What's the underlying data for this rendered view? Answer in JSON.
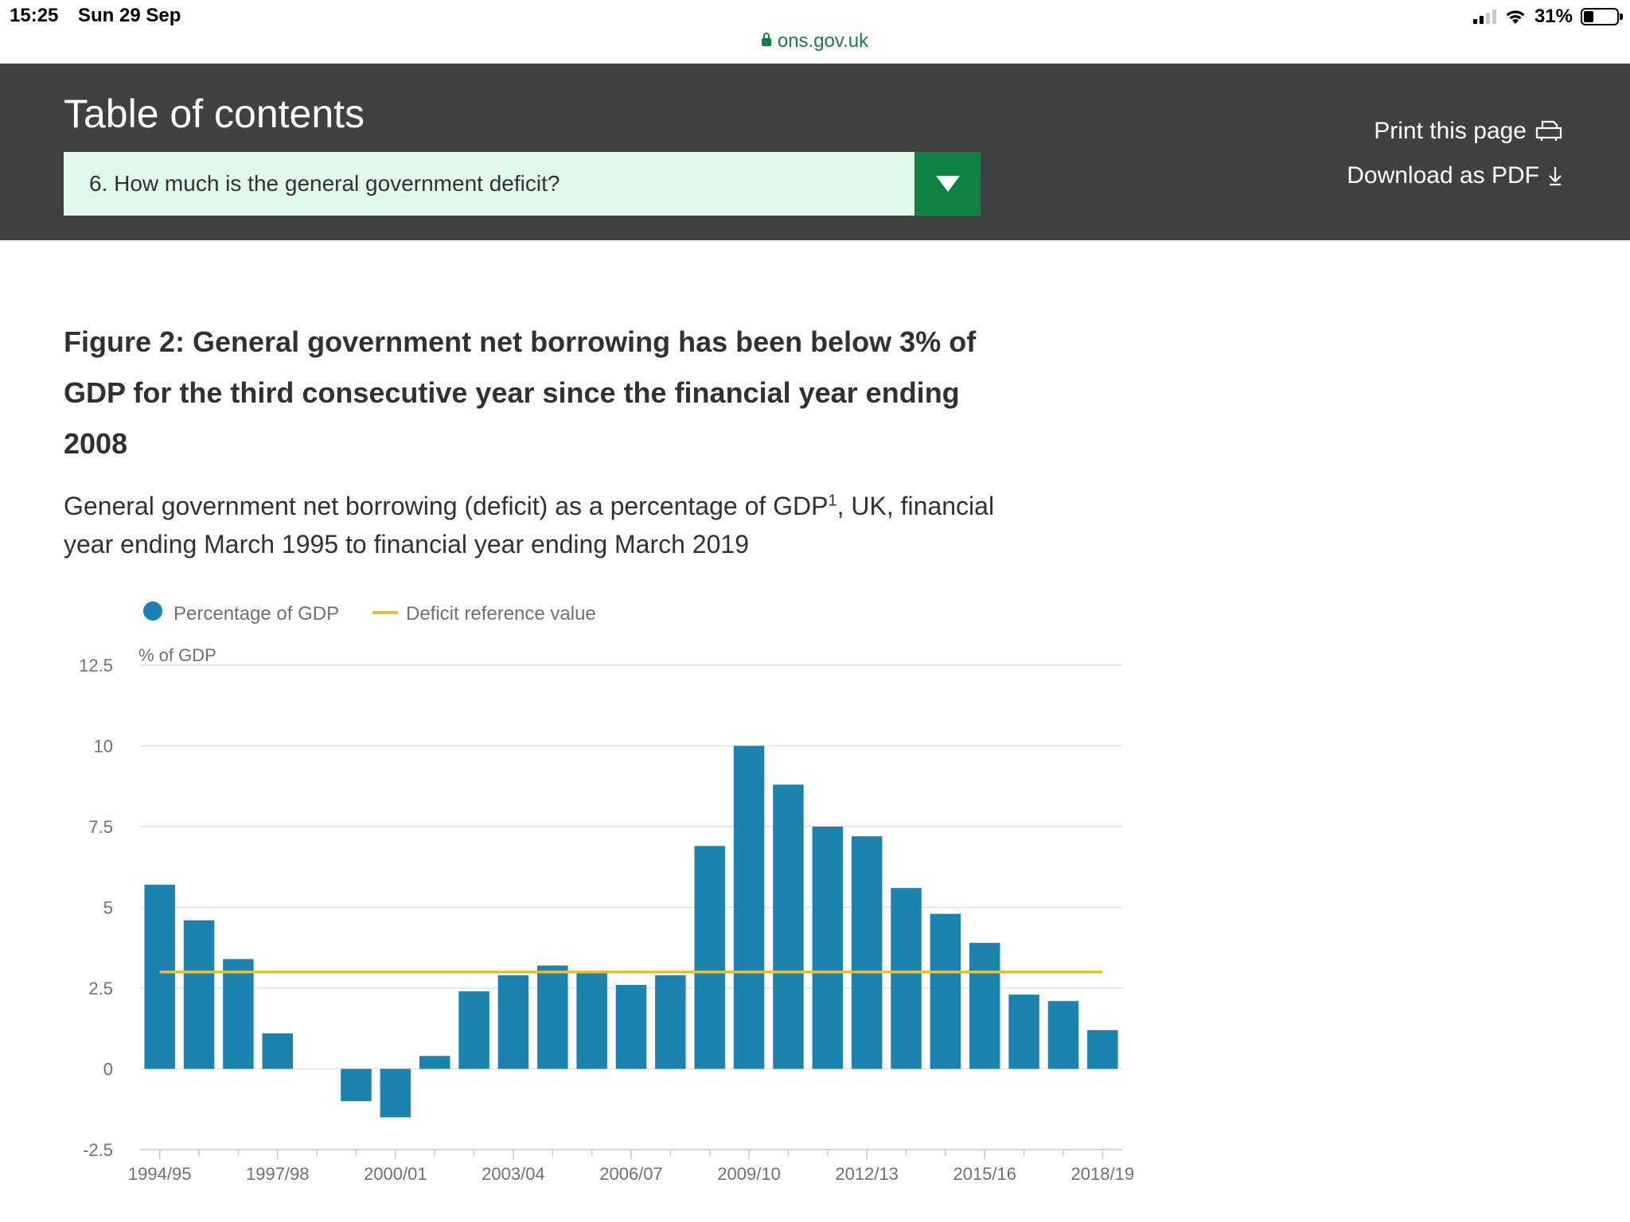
{
  "status_bar": {
    "time": "15:25",
    "date": "Sun 29 Sep",
    "battery": "31%",
    "battery_level": 0.31,
    "url": "ons.gov.uk"
  },
  "toc": {
    "title": "Table of contents",
    "selected": "6. How much is the general government deficit?",
    "print_label": "Print this page",
    "download_label": "Download as PDF",
    "icons": {
      "dropdown": "triangle-down-icon",
      "print": "printer-icon",
      "download": "arrow-down-icon"
    }
  },
  "colors": {
    "header_bg": "#414042",
    "select_bg": "#e0f9eb",
    "accent_green": "#0f8243",
    "bar_blue": "#1b83b0",
    "reference_yellow": "#e5bf3c",
    "text": "#323132"
  },
  "figure": {
    "title": "Figure 2: General government net borrowing has been below 3% of GDP for the third consecutive year since the financial year ending 2008",
    "subtitle_main": "General government net borrowing (deficit) as a percentage of GDP",
    "subtitle_sup": "1",
    "subtitle_tail": ", UK, financial year ending March 1995 to financial year ending March 2019"
  },
  "chart_data": {
    "type": "bar",
    "ylabel": "% of GDP",
    "ylim": [
      -2.5,
      12.5
    ],
    "yticks": [
      -2.5,
      0,
      2.5,
      5,
      7.5,
      10,
      12.5
    ],
    "ytick_labels": [
      "-2.5",
      "0",
      "2.5",
      "5",
      "7.5",
      "10",
      "12.5"
    ],
    "grid": true,
    "legend_position": "top-left",
    "categories": [
      "1994/95",
      "1995/96",
      "1996/97",
      "1997/98",
      "1998/99",
      "1999/00",
      "2000/01",
      "2001/02",
      "2002/03",
      "2003/04",
      "2004/05",
      "2005/06",
      "2006/07",
      "2007/08",
      "2008/09",
      "2009/10",
      "2010/11",
      "2011/12",
      "2012/13",
      "2013/14",
      "2014/15",
      "2015/16",
      "2016/17",
      "2017/18",
      "2018/19"
    ],
    "xtick_labels": [
      "1994/95",
      "1997/98",
      "2000/01",
      "2003/04",
      "2006/07",
      "2009/10",
      "2012/13",
      "2015/16",
      "2018/19"
    ],
    "series": [
      {
        "name": "Percentage of GDP",
        "type": "bar",
        "color": "#1b83b0",
        "values": [
          5.7,
          4.6,
          3.4,
          1.1,
          0,
          -1.0,
          -1.5,
          0.4,
          2.4,
          2.9,
          3.2,
          3.0,
          2.6,
          2.9,
          6.9,
          10.0,
          8.8,
          7.5,
          7.2,
          5.6,
          4.8,
          3.9,
          2.3,
          2.1,
          1.2
        ]
      },
      {
        "name": "Deficit reference value",
        "type": "line",
        "color": "#e5bf3c",
        "value": 3
      }
    ]
  }
}
